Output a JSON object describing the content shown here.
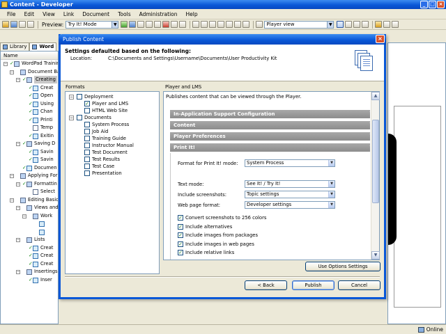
{
  "app": {
    "title": "Content - Developer",
    "menu": [
      "File",
      "Edit",
      "View",
      "Link",
      "Document",
      "Tools",
      "Administration",
      "Help"
    ],
    "toolbar": {
      "preview_label": "Preview:",
      "preview_mode": "Try It! Mode",
      "view_mode": "Player view"
    },
    "tabs": [
      {
        "label": "Library",
        "active": false
      },
      {
        "label": "Word",
        "active": true
      }
    ],
    "outline_header": "Name",
    "outline": [
      {
        "label": "WordPad Training",
        "level": 0,
        "exp": "-",
        "check": true,
        "icon": "book"
      },
      {
        "label": "Document Basics",
        "level": 1,
        "exp": "-",
        "check": false,
        "icon": "book"
      },
      {
        "label": "Creating",
        "level": 2,
        "exp": "-",
        "check": true,
        "icon": "book",
        "selected": true
      },
      {
        "label": "Creat",
        "level": 3,
        "exp": "",
        "check": true,
        "icon": "topic"
      },
      {
        "label": "Open",
        "level": 3,
        "exp": "",
        "check": true,
        "icon": "topic"
      },
      {
        "label": "Using",
        "level": 3,
        "exp": "",
        "check": true,
        "icon": "topic"
      },
      {
        "label": "Chan",
        "level": 3,
        "exp": "",
        "check": true,
        "icon": "topic"
      },
      {
        "label": "Printi",
        "level": 3,
        "exp": "",
        "check": true,
        "icon": "topic"
      },
      {
        "label": "Temp",
        "level": 3,
        "exp": "",
        "check": false,
        "icon": "doc"
      },
      {
        "label": "Exitin",
        "level": 3,
        "exp": "",
        "check": true,
        "icon": "topic"
      },
      {
        "label": "Saving D",
        "level": 2,
        "exp": "-",
        "check": true,
        "icon": "book"
      },
      {
        "label": "Savin",
        "level": 3,
        "exp": "",
        "check": true,
        "icon": "topic"
      },
      {
        "label": "Savin",
        "level": 3,
        "exp": "",
        "check": true,
        "icon": "topic"
      },
      {
        "label": "Documen",
        "level": 2,
        "exp": "",
        "check": true,
        "icon": "topic"
      },
      {
        "label": "Applying Form",
        "level": 1,
        "exp": "-",
        "check": false,
        "icon": "book"
      },
      {
        "label": "Formattin",
        "level": 2,
        "exp": "-",
        "check": true,
        "icon": "book"
      },
      {
        "label": "Select",
        "level": 3,
        "exp": "",
        "check": false,
        "icon": "doc"
      },
      {
        "label": "Editing Basic",
        "level": 1,
        "exp": "-",
        "check": false,
        "icon": "book"
      },
      {
        "label": "Views and",
        "level": 2,
        "exp": "-",
        "check": false,
        "icon": "book"
      },
      {
        "label": "Work",
        "level": 3,
        "exp": "-",
        "check": false,
        "icon": "book"
      },
      {
        "label": "",
        "level": 4,
        "exp": "",
        "check": false,
        "icon": "topic"
      },
      {
        "label": "",
        "level": 4,
        "exp": "",
        "check": false,
        "icon": "topic"
      },
      {
        "label": "Lists",
        "level": 2,
        "exp": "-",
        "check": false,
        "icon": "book"
      },
      {
        "label": "Creat",
        "level": 3,
        "exp": "",
        "check": true,
        "icon": "topic"
      },
      {
        "label": "Creat",
        "level": 3,
        "exp": "",
        "check": true,
        "icon": "topic"
      },
      {
        "label": "Creat",
        "level": 3,
        "exp": "",
        "check": true,
        "icon": "topic"
      },
      {
        "label": "Insertings",
        "level": 2,
        "exp": "-",
        "check": false,
        "icon": "book"
      },
      {
        "label": "Inser",
        "level": 3,
        "exp": "",
        "check": true,
        "icon": "topic"
      }
    ],
    "status": "Online"
  },
  "dialog": {
    "title": "Publish Content",
    "heading": "Settings defaulted based on the following:",
    "location_label": "Location:",
    "location_value": "C:\\Documents and Settings\\Username\\Documents\\User Productivity Kit",
    "formats_label": "Formats",
    "formats": [
      {
        "label": "Deployment",
        "level": 0,
        "exp": "-",
        "checked": false
      },
      {
        "label": "Player and LMS",
        "level": 1,
        "exp": "",
        "checked": true
      },
      {
        "label": "HTML Web Site",
        "level": 1,
        "exp": "",
        "checked": false
      },
      {
        "label": "Documents",
        "level": 0,
        "exp": "-",
        "checked": false
      },
      {
        "label": "System Process",
        "level": 1,
        "exp": "",
        "checked": false
      },
      {
        "label": "Job Aid",
        "level": 1,
        "exp": "",
        "checked": false
      },
      {
        "label": "Training Guide",
        "level": 1,
        "exp": "",
        "checked": false
      },
      {
        "label": "Instructor Manual",
        "level": 1,
        "exp": "",
        "checked": false
      },
      {
        "label": "Test Document",
        "level": 1,
        "exp": "",
        "checked": false
      },
      {
        "label": "Test Results",
        "level": 1,
        "exp": "",
        "checked": false
      },
      {
        "label": "Test Case",
        "level": 1,
        "exp": "",
        "checked": false
      },
      {
        "label": "Presentation",
        "level": 1,
        "exp": "",
        "checked": false
      }
    ],
    "panel_label": "Player and LMS",
    "panel_desc": "Publishes content that can be viewed through the Player.",
    "sections": [
      {
        "label": "In-Application Support Configuration",
        "expanded": false
      },
      {
        "label": "Content",
        "expanded": false
      },
      {
        "label": "Player Preferences",
        "expanded": false
      },
      {
        "label": "Print It!",
        "expanded": true
      }
    ],
    "options": {
      "format_print_label": "Format for Print It! mode:",
      "format_print_value": "System Process",
      "text_mode_label": "Text mode:",
      "text_mode_value": "See It! / Try It!",
      "include_screenshots_label": "Include screenshots:",
      "include_screenshots_value": "Topic settings",
      "web_page_format_label": "Web page format:",
      "web_page_format_value": "Developer settings"
    },
    "checkboxes": [
      {
        "label": "Convert screenshots to 256 colors",
        "checked": true
      },
      {
        "label": "Include alternatives",
        "checked": true
      },
      {
        "label": "Include images from packages",
        "checked": true
      },
      {
        "label": "Include images in web pages",
        "checked": true
      },
      {
        "label": "Include relative links",
        "checked": true
      }
    ],
    "use_options_button": "Use Options Settings",
    "back_button": "< Back",
    "publish_button": "Publish",
    "cancel_button": "Cancel"
  }
}
